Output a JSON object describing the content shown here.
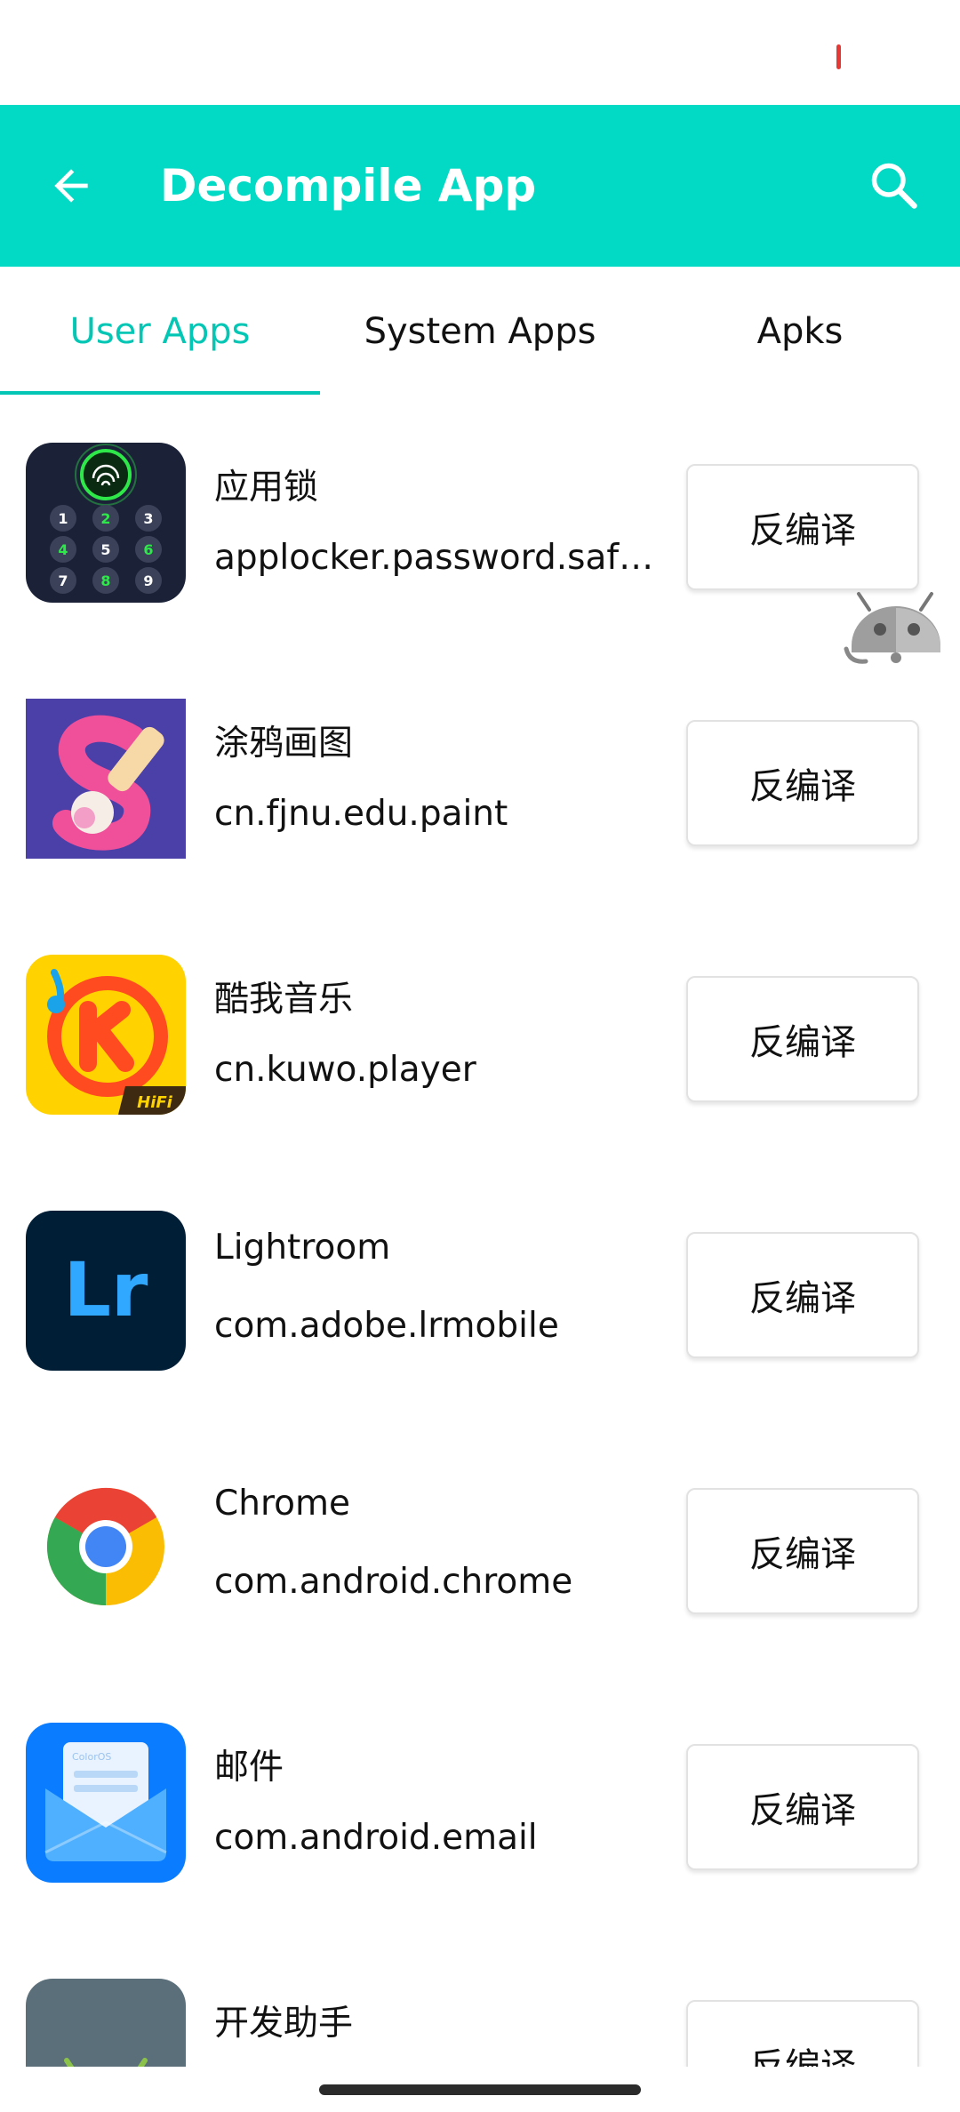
{
  "app_bar": {
    "title": "Decompile App",
    "back_icon": "arrow-back-icon",
    "search_icon": "search-icon",
    "color": "#03dac5"
  },
  "tabs": [
    {
      "label": "User Apps",
      "active": true
    },
    {
      "label": "System Apps",
      "active": false
    },
    {
      "label": "Apks",
      "active": false
    }
  ],
  "accent_color": "#03c7b4",
  "apps": [
    {
      "name": "应用锁",
      "package": "applocker.password.safe...",
      "button": "反编译",
      "icon": "app-lock-icon"
    },
    {
      "name": "涂鸦画图",
      "package": "cn.fjnu.edu.paint",
      "button": "反编译",
      "icon": "paint-icon"
    },
    {
      "name": "酷我音乐",
      "package": "cn.kuwo.player",
      "button": "反编译",
      "icon": "kuwo-music-icon"
    },
    {
      "name": "Lightroom",
      "package": "com.adobe.lrmobile",
      "button": "反编译",
      "icon": "lightroom-icon"
    },
    {
      "name": "Chrome",
      "package": "com.android.chrome",
      "button": "反编译",
      "icon": "chrome-icon"
    },
    {
      "name": "邮件",
      "package": "com.android.email",
      "button": "反编译",
      "icon": "email-icon"
    },
    {
      "name": "开发助手",
      "package": "",
      "button": "反编译",
      "icon": "dev-assistant-icon"
    }
  ],
  "app_lock_icon": {
    "keys": [
      "1",
      "2",
      "3",
      "4",
      "5",
      "6",
      "7",
      "8",
      "9"
    ]
  },
  "lightroom_icon": {
    "text": "Lr"
  },
  "kuwo_icon": {
    "badge": "HiFi"
  },
  "email_icon": {
    "brand": "ColorOS"
  },
  "floating_icon": "android-robot-icon"
}
